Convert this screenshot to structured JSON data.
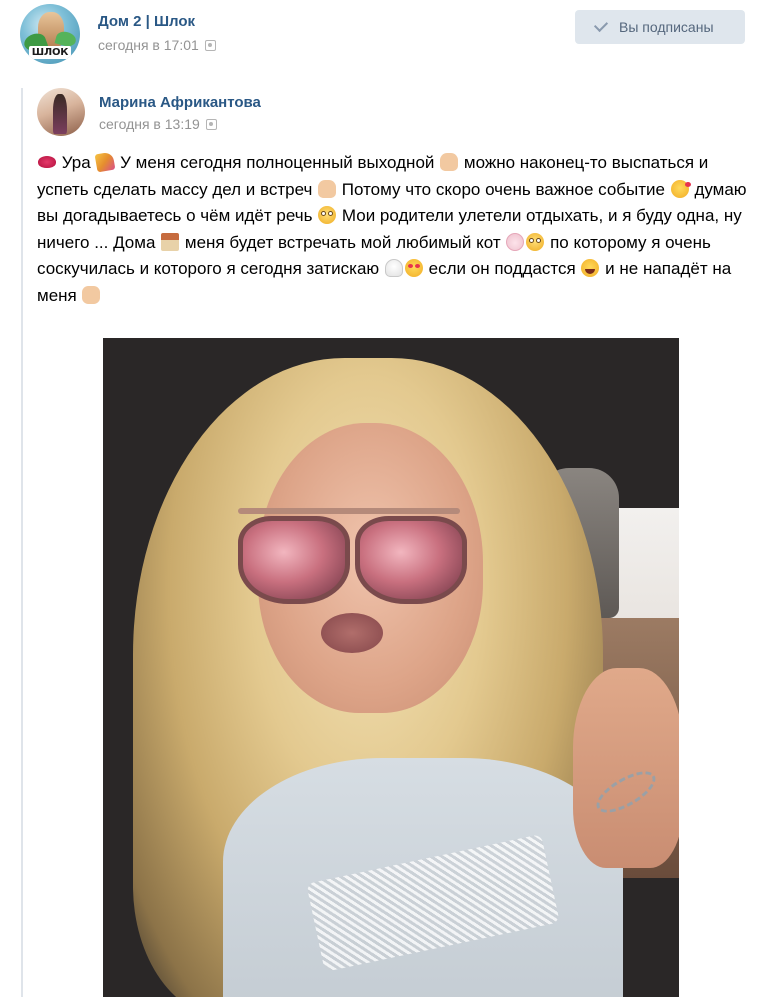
{
  "group": {
    "name": "Дом 2 | Шлок",
    "time": "сегодня в 17:01",
    "avatar_label": "ШЛОК",
    "avatar_icon": "group-avatar-image"
  },
  "subscribe_button": {
    "label": "Вы подписаны",
    "icon": "check-icon"
  },
  "repost": {
    "author_name": "Марина Африкантова",
    "time": "сегодня в 13:19",
    "text_segments": [
      "Ура",
      "У меня сегодня полноценный выходной",
      "можно наконец-то выспаться и успеть сделать массу дел и встреч",
      "Потому что скоро очень важное событие",
      "думаю вы догадываетесь о чём идёт речь",
      "Мои родители улетели отдыхать, и я буду одна, ну ничего ... Дома",
      "меня будет встречать мой любимый кот",
      "по которому я очень соскучилась и которого я сегодня затискаю",
      "если он поддастся",
      "и не нападёт на меня"
    ],
    "emoji": [
      "kiss-mark",
      "party-popper",
      "thumbs-up",
      "thumbs-up",
      "face-blowing-kiss",
      "flushed-face",
      "flushed-face",
      "house-with-garden",
      "cat-face",
      "flushed-face",
      "ghost",
      "heart-eyes",
      "grinning-squinting",
      "fist"
    ],
    "photo_alt": "selfie-photo"
  },
  "colors": {
    "link": "#2a5885",
    "meta": "#939393",
    "button_bg": "#dfe6ed",
    "button_text": "#55677d",
    "repost_bar": "#dfe4ea"
  }
}
